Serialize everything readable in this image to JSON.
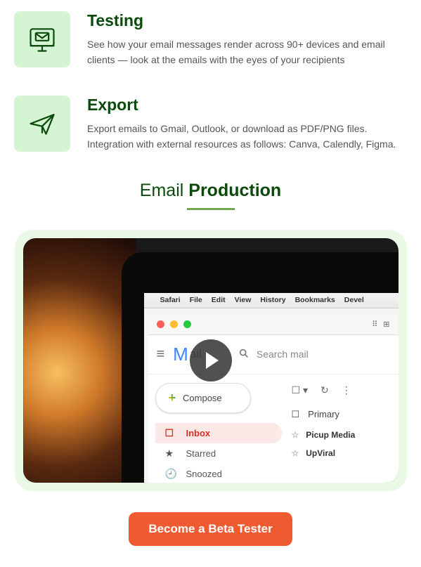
{
  "features": [
    {
      "title": "Testing",
      "description": "See how your email messages render across 90+ devices and email clients — look at the emails with the eyes of your recipients"
    },
    {
      "title": "Export",
      "description": "Export emails to Gmail, Outlook, or download as PDF/PNG files. Integration with external resources as follows: Canva, Calendly, Figma."
    }
  ],
  "section_title": {
    "light": "Email ",
    "bold": "Production"
  },
  "video_preview": {
    "macos_menu": [
      "Safari",
      "File",
      "Edit",
      "View",
      "History",
      "Bookmarks",
      "Devel"
    ],
    "gmail": {
      "logo_text": "ail",
      "search_placeholder": "Search mail",
      "compose": "Compose",
      "sidebar": [
        {
          "label": "Inbox",
          "active": true
        },
        {
          "label": "Starred",
          "active": false
        },
        {
          "label": "Snoozed",
          "active": false
        }
      ],
      "primary_tab": "Primary",
      "mail_rows": [
        "Picup Media",
        "UpViral"
      ]
    }
  },
  "cta_label": "Become a Beta Tester"
}
